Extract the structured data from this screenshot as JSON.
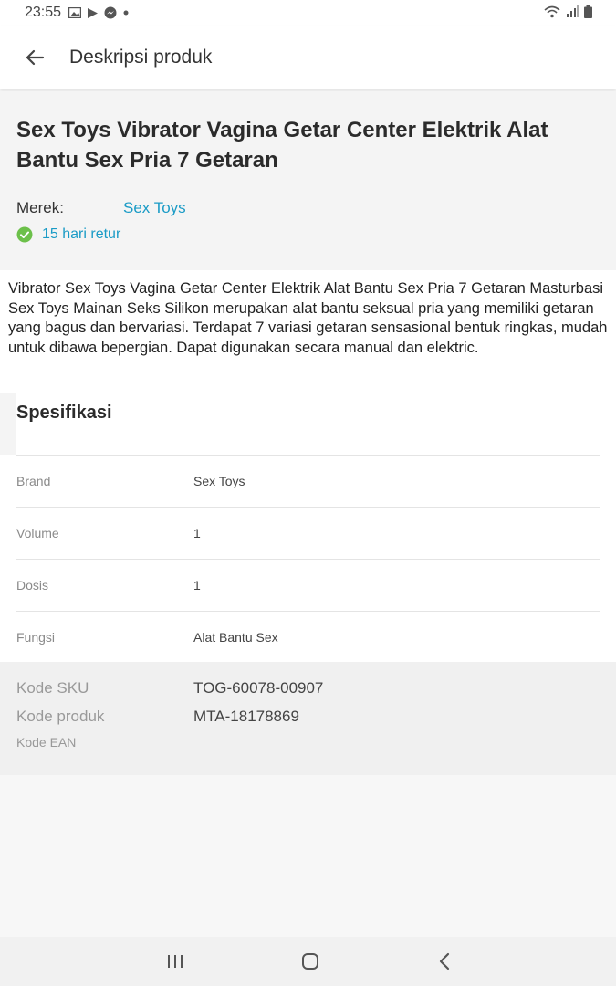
{
  "status_bar": {
    "time": "23:55",
    "left_icons": [
      "gallery-icon",
      "play-store-icon",
      "messenger-icon",
      "dot-icon"
    ],
    "right_icons": [
      "wifi-icon",
      "signal-icon",
      "battery-icon"
    ]
  },
  "app_bar": {
    "title": "Deskripsi produk"
  },
  "product": {
    "title": "Sex Toys Vibrator Vagina Getar Center Elektrik Alat Bantu Sex Pria 7 Getaran",
    "brand_label": "Merek:",
    "brand_value": "Sex Toys",
    "return_text": "15 hari retur"
  },
  "description": "Vibrator Sex Toys Vagina Getar Center Elektrik Alat Bantu Sex Pria 7 Getaran Masturbasi Sex Toys Mainan Seks Silikon merupakan alat bantu seksual pria yang memiliki getaran yang bagus dan bervariasi. Terdapat 7 variasi getaran sensasional bentuk ringkas, mudah untuk dibawa bepergian. Dapat digunakan secara manual dan elektric.",
  "specs": {
    "title": "Spesifikasi",
    "rows": [
      {
        "label": "Brand",
        "value": "Sex Toys"
      },
      {
        "label": "Volume",
        "value": "1"
      },
      {
        "label": "Dosis",
        "value": "1"
      },
      {
        "label": "Fungsi",
        "value": "Alat Bantu Sex"
      }
    ]
  },
  "codes": {
    "sku_label": "Kode SKU",
    "sku_value": "TOG-60078-00907",
    "product_label": "Kode produk",
    "product_value": "MTA-18178869",
    "ean_label": "Kode EAN"
  },
  "colors": {
    "link": "#1a9bc6",
    "check": "#6cc04a",
    "section_bg": "#f4f4f4"
  },
  "nav_bar": {
    "icons": [
      "recent-apps-icon",
      "home-icon",
      "back-icon"
    ]
  }
}
